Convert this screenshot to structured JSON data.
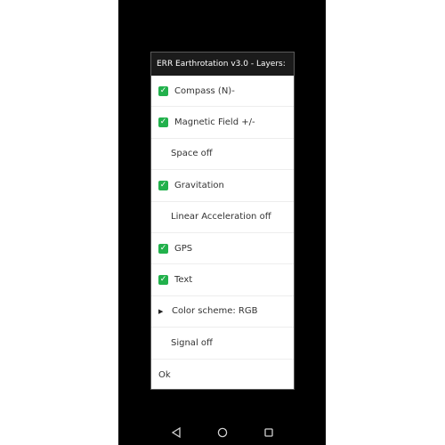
{
  "dialog": {
    "title": "ERR Earthrotation v3.0 - Layers:",
    "items": [
      {
        "label": "Compass (N)-",
        "checked": true
      },
      {
        "label": "Magnetic Field +/-",
        "checked": true
      },
      {
        "label": "Space off",
        "checked": false
      },
      {
        "label": "Gravitation",
        "checked": true
      },
      {
        "label": "Linear Acceleration off",
        "checked": false
      },
      {
        "label": "GPS",
        "checked": true
      },
      {
        "label": "Text",
        "checked": true
      },
      {
        "label": "Color scheme:  RGB",
        "submenu": true
      },
      {
        "label": "Signal off",
        "checked": false
      },
      {
        "label": "Ok"
      }
    ]
  },
  "icons": {
    "check": "check-mark-icon",
    "submenu": "triangle-right-icon",
    "back": "back-triangle-icon",
    "home": "home-circle-icon",
    "recents": "recents-square-icon"
  },
  "colors": {
    "check_green": "#22b14c",
    "title_bar": "#1b1b1b",
    "phone_bg": "#000000"
  }
}
